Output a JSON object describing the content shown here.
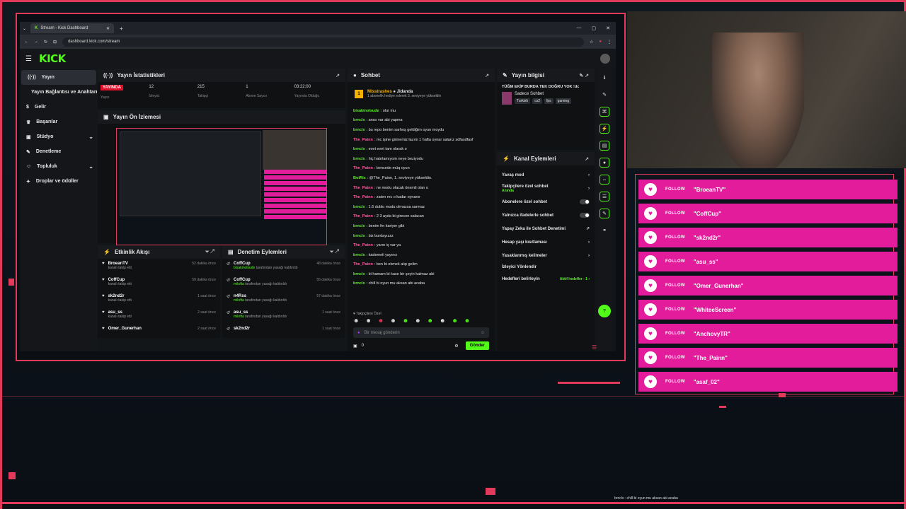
{
  "browser": {
    "tab_title": "Stream - Kick Dashboard",
    "url": "dashboard.kick.com/stream"
  },
  "kick": {
    "logo": "KICK"
  },
  "sidebar": {
    "items": [
      {
        "label": "Yayın",
        "icon": "broadcast-icon"
      },
      {
        "label": "Yayın Bağlantısı ve Anahtarı",
        "icon": "key-icon"
      },
      {
        "label": "Gelir",
        "icon": "money-icon"
      },
      {
        "label": "Başarılar",
        "icon": "trophy-icon"
      },
      {
        "label": "Stüdyo",
        "icon": "studio-icon"
      },
      {
        "label": "Denetleme",
        "icon": "wrench-icon"
      },
      {
        "label": "Topluluk",
        "icon": "people-icon"
      },
      {
        "label": "Droplar ve ödüller",
        "icon": "gift-icon"
      }
    ]
  },
  "stats": {
    "title": "Yayın İstatistikleri",
    "live_label": "YAYINDA",
    "items": [
      {
        "value": "",
        "label": "Yayın"
      },
      {
        "value": "12",
        "label": "İzleyici"
      },
      {
        "value": "215",
        "label": "Takipçi"
      },
      {
        "value": "1",
        "label": "Abone Sayısı"
      },
      {
        "value": "03:22:00",
        "label": "Yayında Olduğu"
      }
    ]
  },
  "preview": {
    "title": "Yayın Ön İzlemesi"
  },
  "activity": {
    "title": "Etkinlik Akışı",
    "rows": [
      {
        "name": "BroeanTV",
        "sub": "kanalı takip etti",
        "time": "52 dakika önce"
      },
      {
        "name": "CoffCup",
        "sub": "kanalı takip etti",
        "time": "59 dakika önce"
      },
      {
        "name": "sk2nd2r",
        "sub": "kanalı takip etti",
        "time": "1 saat önce"
      },
      {
        "name": "asu_ss",
        "sub": "kanalı takip etti",
        "time": "2 saat önce"
      },
      {
        "name": "Omer_Gunerhan",
        "sub": "",
        "time": "2 saat önce"
      }
    ]
  },
  "moderation": {
    "title": "Denetim Eylemleri",
    "rows": [
      {
        "name": "CoffCup",
        "sub1": "bisakinolsude",
        "sub2": "tarafından yasağı kaldırıldı",
        "time": "48 dakika önce"
      },
      {
        "name": "CoffCup",
        "sub1": "milofta",
        "sub2": "tarafından yasağı kaldırıldı",
        "time": "55 dakika önce"
      },
      {
        "name": "n4Rss",
        "sub1": "milofta",
        "sub2": "tarafından yasağı kaldırıldı",
        "time": "57 dakika önce"
      },
      {
        "name": "asu_ss",
        "sub1": "milofta",
        "sub2": "tarafından yasağı kaldırıldı",
        "time": "1 saat önce"
      },
      {
        "name": "sk2nd2r",
        "sub1": "",
        "sub2": "",
        "time": "1 saat önce"
      }
    ]
  },
  "chat": {
    "title": "Sohbet",
    "gift_user": "Misstrashes",
    "gift_target": "Jidanda",
    "gift_text": "1 abonelik hediye ederek 3. seviyeye yükseldin",
    "messages": [
      {
        "user": "bisakinolsude",
        "text": "olur mu",
        "color": "#53fc18"
      },
      {
        "user": "brnclx",
        "text": "anısı var abi yapma",
        "color": "#53fc18"
      },
      {
        "user": "brnclx",
        "text": "bu repo benim sarhoş geldiğim oyun moydu",
        "color": "#53fc18"
      },
      {
        "user": "The_Painn",
        "text": "mc işine girmemiz lazım 1 hafta oynar salarız sdfasdfasf",
        "color": "#ff5aa0"
      },
      {
        "user": "brnclx",
        "text": "evet evet tam olarak o",
        "color": "#53fc18"
      },
      {
        "user": "brnclx",
        "text": "hiç hatırlamıyom neye beziyodu",
        "color": "#53fc18"
      },
      {
        "user": "The_Painn",
        "text": "bencede müq oyun",
        "color": "#ff5aa0"
      },
      {
        "user": "BotRix",
        "text": "@The_Painn, 1. seviyeye yükseldin.",
        "color": "#53fc18"
      },
      {
        "user": "The_Painn",
        "text": "ne modu olacak önemli olan o",
        "color": "#ff5aa0"
      },
      {
        "user": "The_Painn",
        "text": "zaten mc o kadar oynanır",
        "color": "#ff5aa0"
      },
      {
        "user": "brnclx",
        "text": "1.6 doblo modu olmazsa sarmaz",
        "color": "#53fc18"
      },
      {
        "user": "The_Painn",
        "text": "2 3 ayda bi girecen salacan",
        "color": "#ff5aa0"
      },
      {
        "user": "brnclx",
        "text": "benim fm kariyer gibi",
        "color": "#53fc18"
      },
      {
        "user": "brnclx",
        "text": "biz burdayızzz",
        "color": "#53fc18"
      },
      {
        "user": "The_Painn",
        "text": "yarın iş var ya",
        "color": "#ff5aa0"
      },
      {
        "user": "brnclx",
        "text": "kademeli yayıncı",
        "color": "#53fc18"
      },
      {
        "user": "The_Painn",
        "text": "ben bi ekmek alıp gelim",
        "color": "#ff5aa0"
      },
      {
        "user": "brnclx",
        "text": "bi hamam bi kase bir şeyin kalmaz abi",
        "color": "#53fc18"
      },
      {
        "user": "brnclx",
        "text": "chill bi oyun mu aksan abi acaba",
        "color": "#53fc18"
      }
    ],
    "followers_label": "Takipçilere Özel",
    "input_placeholder": "Bir mesaj gönderin",
    "count": "0",
    "send_label": "Gönder"
  },
  "stream_info": {
    "title": "Yayın bilgisi",
    "stream_title": "TÜĞM EKİP BURDA TEK DOĞRU YOK !dc",
    "category": "Sadece Sohbet",
    "tags": [
      "Turkish",
      "cs2",
      "fps",
      "gaming"
    ]
  },
  "channel_actions": {
    "title": "Kanal Eylemleri",
    "rows": [
      {
        "label": "Yavaş mod",
        "right": "›",
        "sub": ""
      },
      {
        "label": "Takipçilere özel sohbet",
        "right": "›",
        "sub": "Anında"
      },
      {
        "label": "Abonelere özel sohbet",
        "right": "toggle",
        "sub": ""
      },
      {
        "label": "Yalnızca ifadelerle sohbet",
        "right": "toggle",
        "sub": ""
      },
      {
        "label": "Yapay Zeka ile Sohbet Denetimi",
        "right": "↗",
        "sub": ""
      },
      {
        "label": "Hesap yaşı kısıtlaması",
        "right": "›",
        "sub": ""
      },
      {
        "label": "Yasaklanmış kelimeler",
        "right": "›",
        "sub": ""
      },
      {
        "label": "İzleyici Yönlendir",
        "right": "",
        "sub": ""
      },
      {
        "label": "Hedefleri belirleyin",
        "right": "Aktif hedefler - 1 ›",
        "sub": ""
      }
    ]
  },
  "overlay_follows": {
    "follow_label": "FOLLOW",
    "names": [
      "\"BroeanTV\"",
      "\"CoffCup\"",
      "\"sk2nd2r\"",
      "\"asu_ss\"",
      "\"Omer_Gunerhan\"",
      "\"WhiteeScreen\"",
      "\"AnchovyTR\"",
      "\"The_Painn\"",
      "\"asaf_02\""
    ]
  },
  "ticker": "brnclx : chill bi oyun mu aksan abi acaba",
  "colors": {
    "accent": "#53fc18",
    "overlay_pink": "#e21c9a",
    "frame_red": "#e23a5b"
  }
}
